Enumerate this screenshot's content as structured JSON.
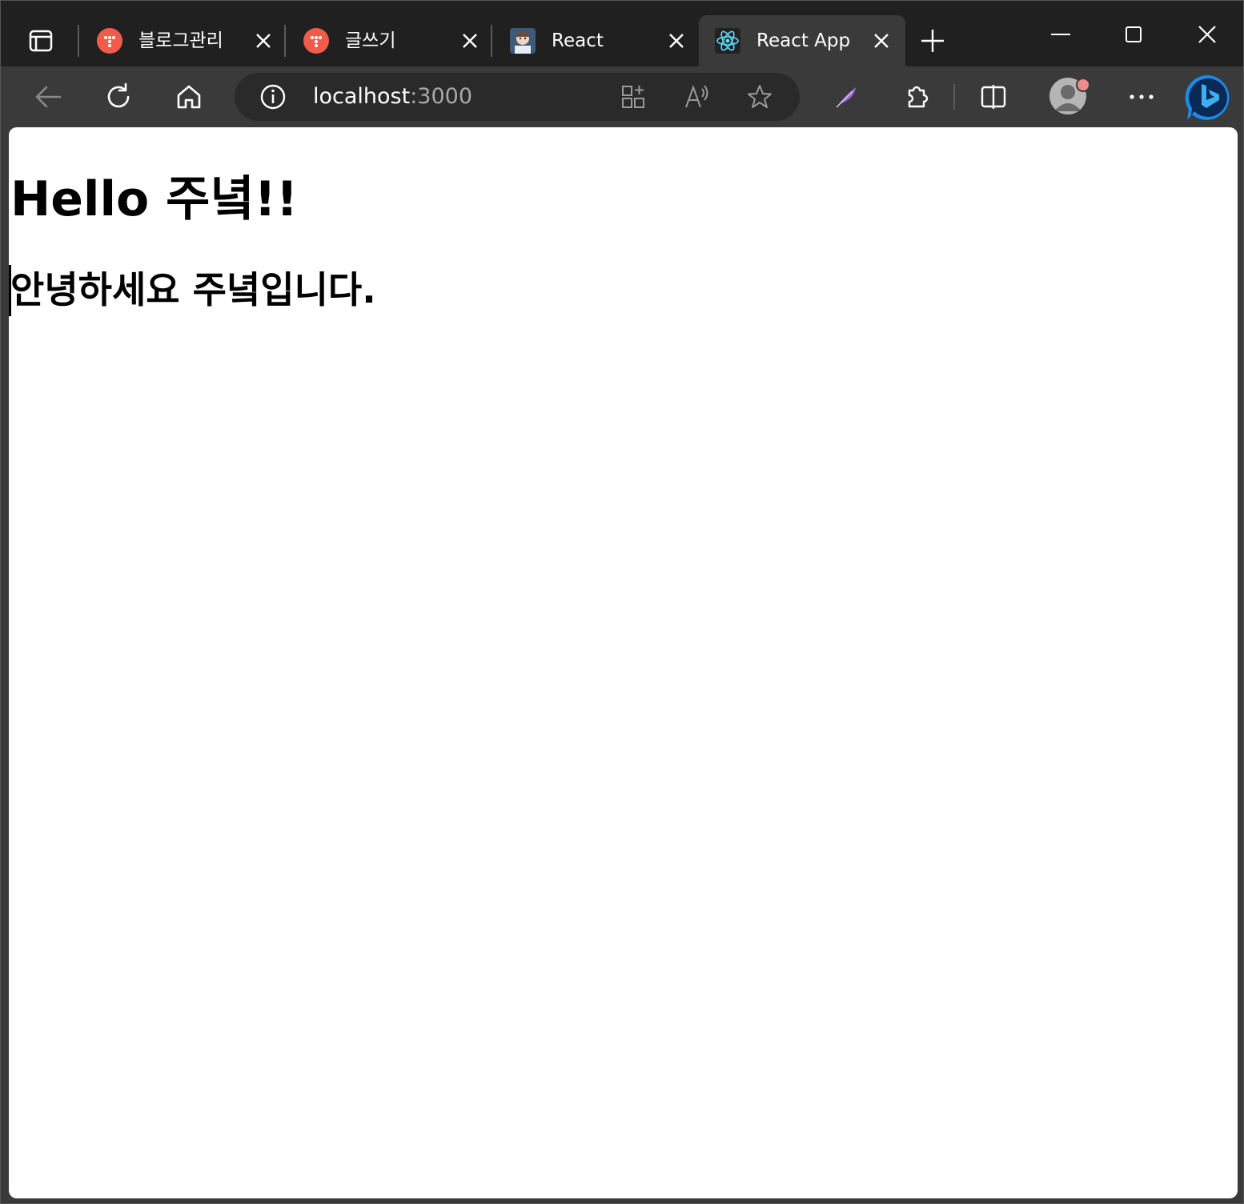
{
  "tabs": [
    {
      "title": "블로그관리",
      "favicon": "tistory-icon",
      "active": false
    },
    {
      "title": "글쓰기",
      "favicon": "tistory-icon",
      "active": false
    },
    {
      "title": "React",
      "favicon": "avatar-favicon-icon",
      "active": false
    },
    {
      "title": "React App",
      "favicon": "react-logo-icon",
      "active": true
    }
  ],
  "address_bar": {
    "host": "localhost",
    "port": ":3000"
  },
  "page": {
    "heading": "Hello 주녘!!",
    "subheading": "안녕하세요 주녘입니다."
  },
  "colors": {
    "tistory": "#f05b4a",
    "react": "#61dafb",
    "bing": "#1c8ae8"
  }
}
